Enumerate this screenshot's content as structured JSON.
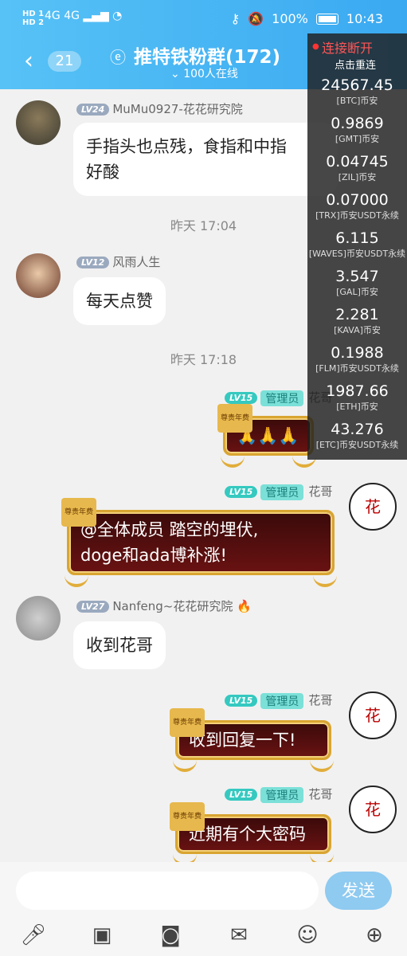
{
  "status": {
    "sim_labels": [
      "HD 1",
      "HD 2"
    ],
    "network": "4G 4G",
    "battery": "100%",
    "time": "10:43"
  },
  "header": {
    "back_icon": "chevron-left-icon",
    "unread_count": "21",
    "title": "推特铁粉群(172)",
    "online": "100人在线"
  },
  "ticker": {
    "status": "连接断开",
    "action": "点击重连",
    "items": [
      {
        "price": "24567.45",
        "symbol": "[BTC]币安"
      },
      {
        "price": "0.9869",
        "symbol": "[GMT]币安"
      },
      {
        "price": "0.04745",
        "symbol": "[ZIL]币安"
      },
      {
        "price": "0.07000",
        "symbol": "[TRX]币安USDT永续"
      },
      {
        "price": "6.115",
        "symbol": "[WAVES]币安USDT永续"
      },
      {
        "price": "3.547",
        "symbol": "[GAL]币安"
      },
      {
        "price": "2.281",
        "symbol": "[KAVA]币安"
      },
      {
        "price": "0.1988",
        "symbol": "[FLM]币安USDT永续"
      },
      {
        "price": "1987.66",
        "symbol": "[ETH]币安"
      },
      {
        "price": "43.276",
        "symbol": "[ETC]币安USDT永续"
      }
    ]
  },
  "messages": {
    "m1": {
      "level": "LV24",
      "name": "MuMu0927-花花研究院",
      "text1": "手指头也点残，食指和中指",
      "text2": "好酸"
    },
    "t1": "昨天 17:04",
    "m2": {
      "level": "LV12",
      "name": "风雨人生",
      "text": "每天点赞"
    },
    "t2": "昨天 17:18",
    "m3": {
      "level": "LV15",
      "role": "管理员",
      "name": "花哥",
      "text": "🙏🙏🙏"
    },
    "m4": {
      "level": "LV15",
      "role": "管理员",
      "name": "花哥",
      "text1": "@全体成员 踏空的埋伏,",
      "text2": "doge和ada博补涨!"
    },
    "m5": {
      "level": "LV27",
      "name": "Nanfeng~花花研究院",
      "emoji": "🔥",
      "text": "收到花哥"
    },
    "m6": {
      "level": "LV15",
      "role": "管理员",
      "name": "花哥",
      "text": "收到回复一下!"
    },
    "m7": {
      "level": "LV15",
      "role": "管理员",
      "name": "花哥",
      "text": "近期有个大密码"
    },
    "badge": "尊贵年费"
  },
  "input": {
    "send": "发送"
  }
}
